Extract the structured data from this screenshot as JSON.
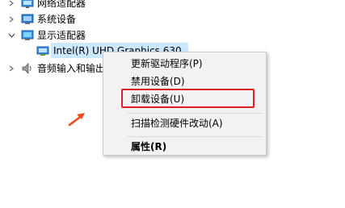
{
  "tree": {
    "items": [
      {
        "label": "网络适配器",
        "icon": "network-adapter-icon",
        "expanded": false
      },
      {
        "label": "系统设备",
        "icon": "system-device-icon",
        "expanded": false
      },
      {
        "label": "显示适配器",
        "icon": "display-adapter-icon",
        "expanded": true
      },
      {
        "label": "Intel(R) UHD Graphics 630",
        "icon": "display-device-icon",
        "selected": true
      },
      {
        "label": "音频输入和输出",
        "icon": "audio-device-icon",
        "expanded": false
      }
    ]
  },
  "context_menu": {
    "items": [
      {
        "label": "更新驱动程序(P)",
        "bold": false
      },
      {
        "label": "禁用设备(D)",
        "bold": false
      },
      {
        "label": "卸载设备(U)",
        "bold": false,
        "highlighted": true
      },
      {
        "label": "扫描检测硬件改动(A)",
        "bold": false
      },
      {
        "label": "属性(R)",
        "bold": true
      }
    ]
  },
  "annotation": {
    "highlight_color": "#e02020",
    "arrow_color": "#f04a1a"
  },
  "colors": {
    "selection": "#cce8ff",
    "menu_background": "#f2f2f2",
    "menu_border": "#cccccc"
  }
}
